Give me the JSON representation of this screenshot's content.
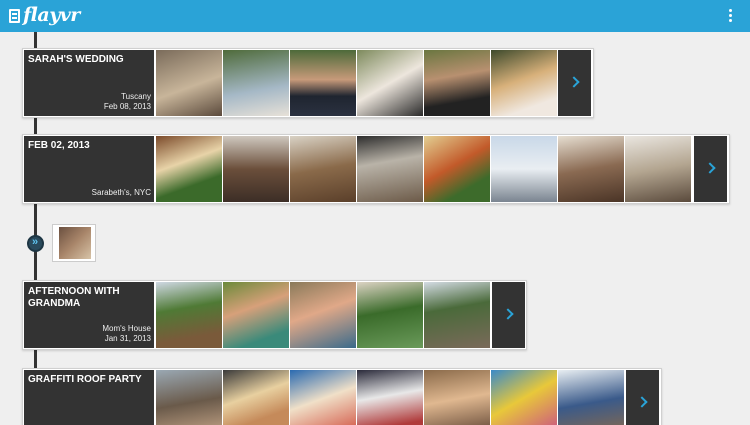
{
  "app": {
    "name": "flayvr",
    "icon": "flayvr-logo-icon",
    "overflow_icon": "overflow-menu-icon"
  },
  "colors": {
    "accent": "#2aa3d7",
    "card_dark": "#333333",
    "background": "#efefef"
  },
  "events": [
    {
      "title": "SARAH'S WEDDING",
      "location": "Tuscany",
      "date": "Feb 08, 2013",
      "photos": [
        {
          "name": "wedding-photo-1",
          "desc": "guests-at-table"
        },
        {
          "name": "wedding-photo-2",
          "desc": "table-with-flowers"
        },
        {
          "name": "wedding-photo-3",
          "desc": "groom-portrait"
        },
        {
          "name": "wedding-photo-4",
          "desc": "bride-in-white"
        },
        {
          "name": "wedding-photo-5",
          "desc": "ceremony-kiss"
        },
        {
          "name": "wedding-photo-6",
          "desc": "bride-smiling"
        }
      ],
      "has_more": true
    },
    {
      "title": "FEB 02, 2013",
      "location": "Sarabeth's, NYC",
      "date": "",
      "photos": [
        {
          "name": "brunch-photo-1",
          "desc": "eggs-and-salad"
        },
        {
          "name": "brunch-photo-2",
          "desc": "two-friends"
        },
        {
          "name": "brunch-photo-3",
          "desc": "restaurant-table"
        },
        {
          "name": "brunch-photo-4",
          "desc": "pastry-display"
        },
        {
          "name": "brunch-photo-5",
          "desc": "plated-food"
        },
        {
          "name": "brunch-photo-6",
          "desc": "skyscraper"
        },
        {
          "name": "brunch-photo-7",
          "desc": "cafe-interior"
        },
        {
          "name": "brunch-photo-8",
          "desc": "living-room"
        }
      ],
      "has_more": true
    },
    {
      "title": "AFTERNOON WITH GRANDMA",
      "location": "Mom's House",
      "date": "Jan 31, 2013",
      "photos": [
        {
          "name": "grandma-photo-1",
          "desc": "kids-outdoors"
        },
        {
          "name": "grandma-photo-2",
          "desc": "face-paint-selfie"
        },
        {
          "name": "grandma-photo-3",
          "desc": "painted-faces"
        },
        {
          "name": "grandma-photo-4",
          "desc": "child-with-grandma"
        },
        {
          "name": "grandma-photo-5",
          "desc": "garden-visit"
        }
      ],
      "has_more": true
    },
    {
      "title": "GRAFFITI ROOF PARTY",
      "location": "",
      "date": "",
      "photos": [
        {
          "name": "party-photo-1",
          "desc": "crowd-on-roof"
        },
        {
          "name": "party-photo-2",
          "desc": "sunset-group"
        },
        {
          "name": "party-photo-3",
          "desc": "graffiti-friends"
        },
        {
          "name": "party-photo-4",
          "desc": "man-in-cap"
        },
        {
          "name": "party-photo-5",
          "desc": "smiling-friends"
        },
        {
          "name": "party-photo-6",
          "desc": "graffiti-wall"
        },
        {
          "name": "party-photo-7",
          "desc": "rooftop-dancers"
        }
      ],
      "has_more": true
    }
  ],
  "collapsed_group": {
    "icon": "double-chevron-right-icon",
    "count": 1
  }
}
